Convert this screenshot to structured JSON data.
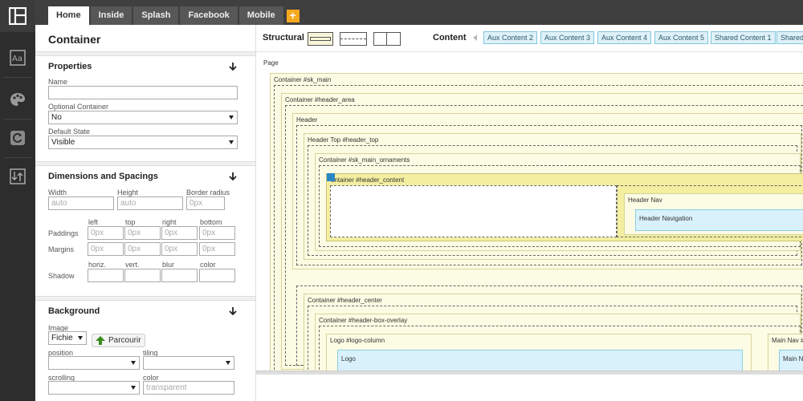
{
  "tabs": [
    {
      "label": "Home",
      "active": true
    },
    {
      "label": "Inside",
      "active": false
    },
    {
      "label": "Splash",
      "active": false
    },
    {
      "label": "Facebook",
      "active": false
    },
    {
      "label": "Mobile",
      "active": false
    }
  ],
  "tabs_add_label": "+",
  "rail": {
    "items": [
      "layout-icon",
      "typography-icon",
      "palette-icon",
      "refresh-icon",
      "swap-icon"
    ]
  },
  "panel": {
    "title": "Container",
    "properties": {
      "title": "Properties",
      "name_label": "Name",
      "name_value": "",
      "optional_label": "Optional Container",
      "optional_value": "No",
      "default_state_label": "Default State",
      "default_state_value": "Visible"
    },
    "dimensions": {
      "title": "Dimensions and Spacings",
      "width_label": "Width",
      "height_label": "Height",
      "radius_label": "Border radius",
      "width_placeholder": "auto",
      "height_placeholder": "auto",
      "radius_placeholder": "0px",
      "col_left": "left",
      "col_top": "top",
      "col_right": "right",
      "col_bottom": "bottom",
      "paddings_label": "Paddings",
      "margins_label": "Margins",
      "spacing_placeholder": "0px",
      "shadow_col_horiz": "horiz.",
      "shadow_col_vert": "vert.",
      "shadow_col_blur": "blur",
      "shadow_col_color": "color",
      "shadow_label": "Shadow"
    },
    "background": {
      "title": "Background",
      "image_label": "Image",
      "image_value": "Fichie",
      "browse_label": "Parcourir",
      "position_label": "position",
      "tiling_label": "tiling",
      "scrolling_label": "scrolling",
      "color_label": "color",
      "color_placeholder": "transparent"
    }
  },
  "toolbar": {
    "structural_label": "Structural",
    "content_label": "Content",
    "aux_buttons": [
      "Aux Content 2",
      "Aux Content 3",
      "Aux Content 4",
      "Aux Content 5",
      "Shared Content 1",
      "Shared"
    ]
  },
  "canvas": {
    "page_label": "Page",
    "sk_main": "Container #sk_main",
    "header_area": "Container #header_area",
    "header": "Header",
    "header_top": "Header Top #header_top",
    "sk_main_ornaments": "Container #sk_main_ornaments",
    "header_content": "ontainer #header_content",
    "header_nav": "Header Nav",
    "header_navigation": "Header Navigation",
    "header_center": "Container #header_center",
    "header_box_overlay": "Container #header-box-overlay",
    "logo_column": "Logo #logo-column",
    "logo": "Logo",
    "main_nav": "Main Nav #",
    "main_n": "Main N"
  },
  "colors": {
    "accent_orange": "#f6a81e",
    "container_yellow": "#fcfbe3",
    "selected_yellow": "#f3eea0",
    "content_blue": "#d9f1fb"
  }
}
